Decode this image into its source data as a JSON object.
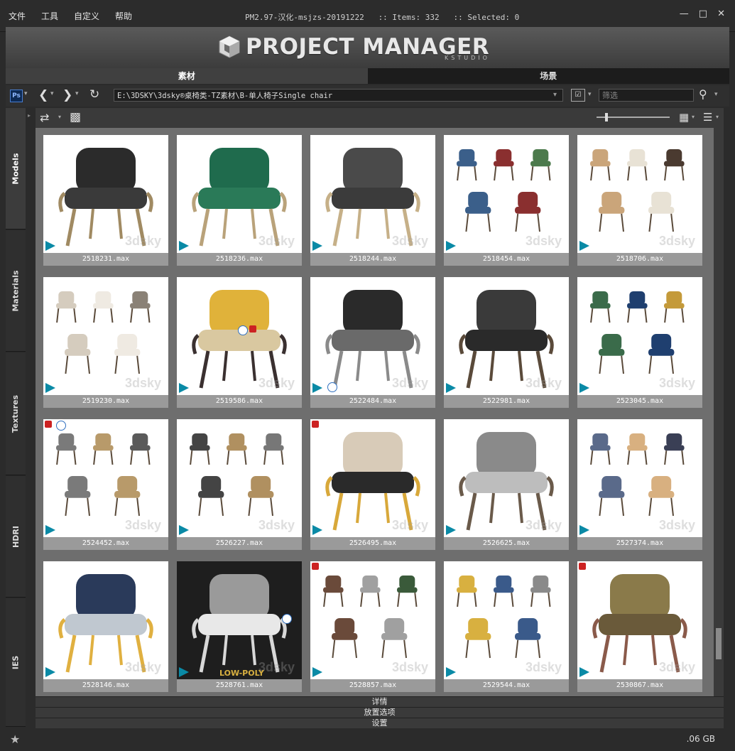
{
  "menu": [
    "文件",
    "工具",
    "自定义",
    "帮助"
  ],
  "window_title": "PM2.97-汉化-msjzs-20191222   :: Items: 332   :: Selected: 0",
  "logo": {
    "text": "PROJECT MANAGER",
    "sub": "KSTUDIO"
  },
  "main_tabs": [
    "素材",
    "场景"
  ],
  "toolbar": {
    "ps_label": "Ps",
    "path": "E:\\3DSKY\\3dsky®桌椅类-TZ素材\\B-单人椅子Single chair",
    "filter_placeholder": "筛选"
  },
  "side_tabs": [
    "Models",
    "Materials",
    "Textures",
    "HDRI",
    "IES"
  ],
  "items": [
    {
      "name": "2518231.max",
      "thumb": "chair-1"
    },
    {
      "name": "2518236.max",
      "thumb": "chair-2"
    },
    {
      "name": "2518244.max",
      "thumb": "chair-3"
    },
    {
      "name": "2518454.max",
      "thumb": "chair-4"
    },
    {
      "name": "2518706.max",
      "thumb": "chair-5"
    },
    {
      "name": "2519230.max",
      "thumb": "chair-6"
    },
    {
      "name": "2519586.max",
      "thumb": "chair-7"
    },
    {
      "name": "2522484.max",
      "thumb": "chair-8"
    },
    {
      "name": "2522981.max",
      "thumb": "chair-9"
    },
    {
      "name": "2523045.max",
      "thumb": "chair-10"
    },
    {
      "name": "2524452.max",
      "thumb": "chair-11"
    },
    {
      "name": "2526227.max",
      "thumb": "chair-12"
    },
    {
      "name": "2526495.max",
      "thumb": "chair-13"
    },
    {
      "name": "2526625.max",
      "thumb": "chair-14"
    },
    {
      "name": "2527374.max",
      "thumb": "chair-15"
    },
    {
      "name": "2528146.max",
      "thumb": "chair-16"
    },
    {
      "name": "2528761.max",
      "thumb": "chair-17"
    },
    {
      "name": "2528857.max",
      "thumb": "chair-18"
    },
    {
      "name": "2529544.max",
      "thumb": "chair-19"
    },
    {
      "name": "2530867.max",
      "thumb": "chair-20"
    }
  ],
  "thumb_texts": {
    "watermark": "3dsky",
    "low_poly": "LOW-POLY"
  },
  "bottom_panels": [
    "详情",
    "放置选项",
    "设置"
  ],
  "status": {
    "size": ".06 GB"
  }
}
